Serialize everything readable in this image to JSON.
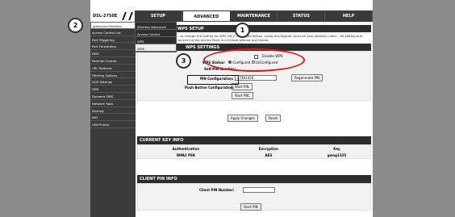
{
  "nav": {
    "brand": "DSL-2750E",
    "tabs": [
      "SETUP",
      "ADVANCED",
      "MAINTENANCE",
      "STATUS",
      "HELP"
    ]
  },
  "sidebar": {
    "items": [
      "Advanced Wireless",
      "Access Control List",
      "Port Triggering",
      "Port Forwarding",
      "DMZ",
      "Parental Control",
      "URL Redirect",
      "Filtering Options",
      "DOS Settings",
      "DNS",
      "Dynamic DNS",
      "Network Tools",
      "Routing",
      "NAT",
      "USB Printer"
    ]
  },
  "submenu": {
    "items": [
      "Wireless Advanced",
      "Access Control",
      "WPS",
      "WDS"
    ]
  },
  "wps": {
    "header": "WPS SETUP",
    "desc": "...to change the setting for WPS (Wi-Fi Protected Setup). Using this feature could let your wireless client ...its setting and connect to the Access Point in a minute without any hassle.",
    "settings_header": "WPS SETTINGS",
    "disable_label": "Disable WPS",
    "status_label": "WPS Status:",
    "status_opt1": "Configured",
    "status_opt2": "UnConfigured",
    "pin_label": "Self-PIN Number:",
    "pin_value": "27461426",
    "regen_btn": "Regenerate PIN",
    "pin_cfg_label": "PIN Configuration:",
    "start_pin": "Start PIN",
    "pbc_label": "Push Button Configuration:",
    "start_pbc": "Start PBC",
    "apply": "Apply Changes",
    "reset": "Reset"
  },
  "keyinfo": {
    "header": "CURRENT KEY INFO",
    "cols": [
      "Authentication",
      "Encryption",
      "Key"
    ],
    "row": [
      "WPA2 PSK",
      "AES",
      "gwng1325"
    ]
  },
  "client": {
    "header": "CLIENT PIN INFO",
    "label": "Client PIN Number:",
    "btn": "Start PIN"
  },
  "annotations": [
    "1",
    "2",
    "3"
  ]
}
